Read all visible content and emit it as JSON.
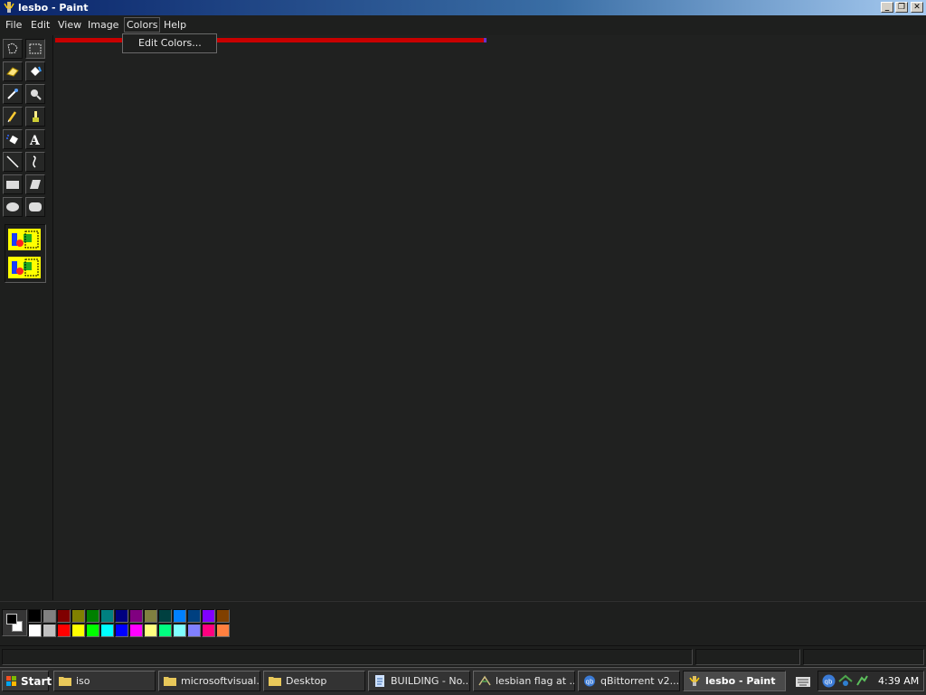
{
  "window": {
    "title": "lesbo - Paint"
  },
  "menu": {
    "items": [
      "File",
      "Edit",
      "View",
      "Image",
      "Colors",
      "Help"
    ],
    "open_menu": "Colors",
    "dropdown_items": [
      "Edit Colors..."
    ]
  },
  "tools": [
    "free-form-select",
    "select",
    "eraser",
    "fill",
    "pick-color",
    "magnifier",
    "pencil",
    "brush",
    "airbrush",
    "text",
    "line",
    "curve",
    "rectangle",
    "polygon",
    "ellipse",
    "rounded-rectangle"
  ],
  "active_tool": "select",
  "colors": {
    "foreground": "#000000",
    "background": "#ffffff",
    "palette_row1": [
      "#000000",
      "#808080",
      "#800000",
      "#808000",
      "#008000",
      "#008080",
      "#000080",
      "#800080",
      "#808040",
      "#004040",
      "#0080ff",
      "#004080",
      "#8000ff",
      "#804000"
    ],
    "palette_row2": [
      "#ffffff",
      "#c0c0c0",
      "#ff0000",
      "#ffff00",
      "#00ff00",
      "#00ffff",
      "#0000ff",
      "#ff00ff",
      "#ffff80",
      "#00ff80",
      "#80ffff",
      "#8080ff",
      "#ff0080",
      "#ff8040"
    ],
    "canvas_stripe": "#c80000"
  },
  "taskbar": {
    "start_label": "Start",
    "tasks": [
      {
        "label": "iso",
        "icon": "folder-icon"
      },
      {
        "label": "microsoftvisual...",
        "icon": "folder-icon"
      },
      {
        "label": "Desktop",
        "icon": "folder-icon"
      },
      {
        "label": "BUILDING - No...",
        "icon": "notepad-icon"
      },
      {
        "label": "lesbian flag at ...",
        "icon": "browser-icon"
      },
      {
        "label": "qBittorrent v2....",
        "icon": "qbittorrent-icon"
      },
      {
        "label": "lesbo - Paint",
        "icon": "paint-icon",
        "active": true
      }
    ],
    "clock": "4:39 AM"
  }
}
